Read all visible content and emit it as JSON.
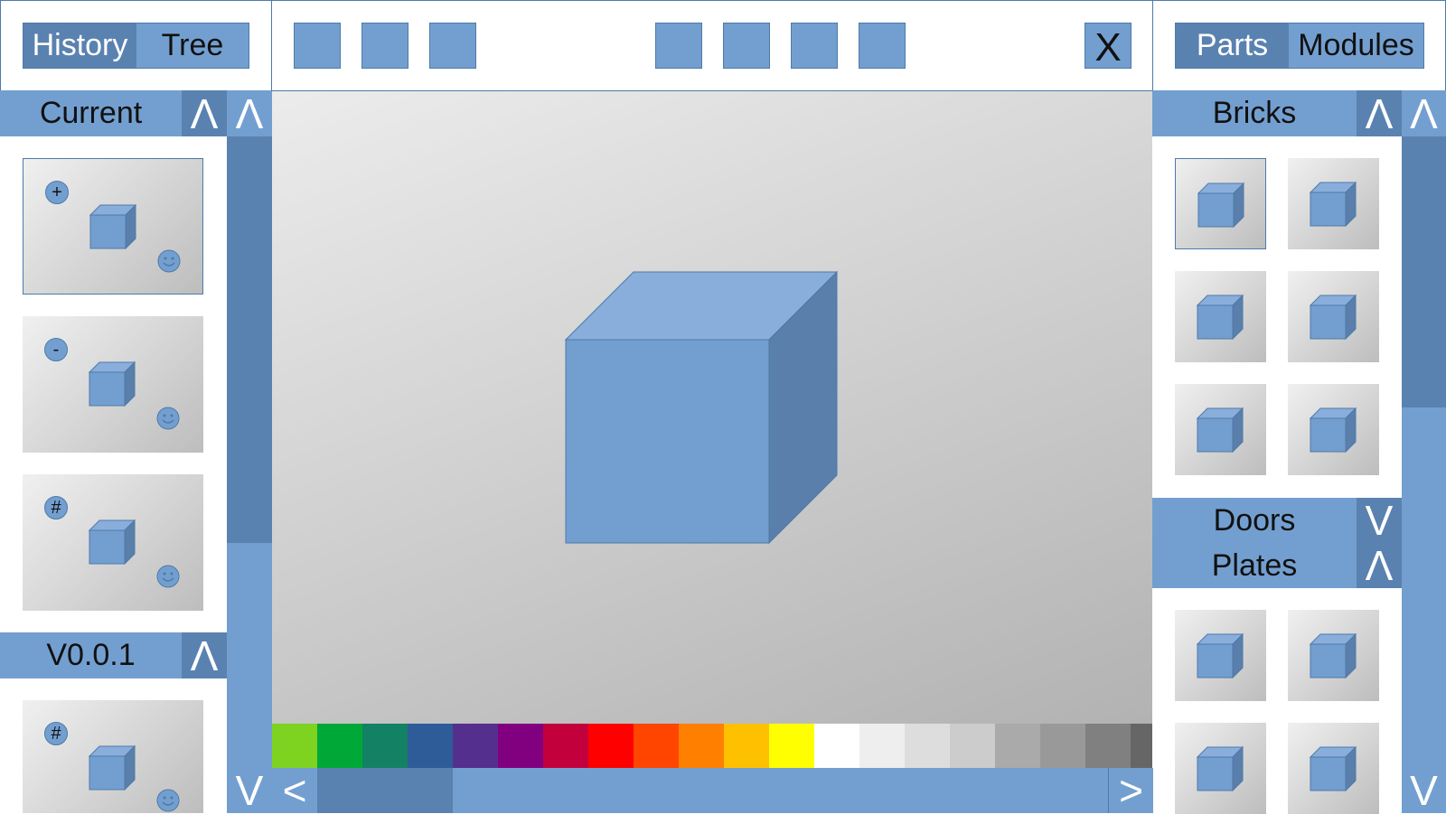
{
  "left_tabs": [
    {
      "label": "History",
      "active": true
    },
    {
      "label": "Tree",
      "active": false
    }
  ],
  "right_tabs": [
    {
      "label": "Parts",
      "active": true
    },
    {
      "label": "Modules",
      "active": false
    }
  ],
  "toolbar": {
    "close_label": "X"
  },
  "left_panel": {
    "section_title": "Current",
    "collapse_symbol": "Λ",
    "scroll_up_symbol": "Λ",
    "scroll_down_symbol": "V",
    "history_items": [
      {
        "badge": "+"
      },
      {
        "badge": "-"
      },
      {
        "badge": "#"
      }
    ],
    "version_section": {
      "title": "V0.0.1",
      "collapse_symbol": "Λ",
      "items": [
        {
          "badge": "#"
        }
      ]
    }
  },
  "right_panel": {
    "scroll_up_symbol": "Λ",
    "scroll_down_symbol": "V",
    "categories": [
      {
        "title": "Bricks",
        "toggle": "Λ",
        "expanded": true
      },
      {
        "title": "Doors",
        "toggle": "V",
        "expanded": false
      },
      {
        "title": "Plates",
        "toggle": "Λ",
        "expanded": true
      }
    ]
  },
  "palette": {
    "scroll_left_symbol": "<",
    "scroll_right_symbol": ">",
    "colors": [
      "#7ed321",
      "#00a838",
      "#138163",
      "#2e5c98",
      "#552f8e",
      "#800080",
      "#c2003c",
      "#ff0000",
      "#ff4500",
      "#ff8000",
      "#ffc000",
      "#ffff00",
      "#ffffff",
      "#eeeeee",
      "#dddddd",
      "#cccccc",
      "#aaaaaa",
      "#999999",
      "#808080",
      "#666666"
    ]
  },
  "theme": {
    "accent": "#739fd0",
    "accent_dark": "#5a82b0",
    "border": "#4e7aa8"
  }
}
